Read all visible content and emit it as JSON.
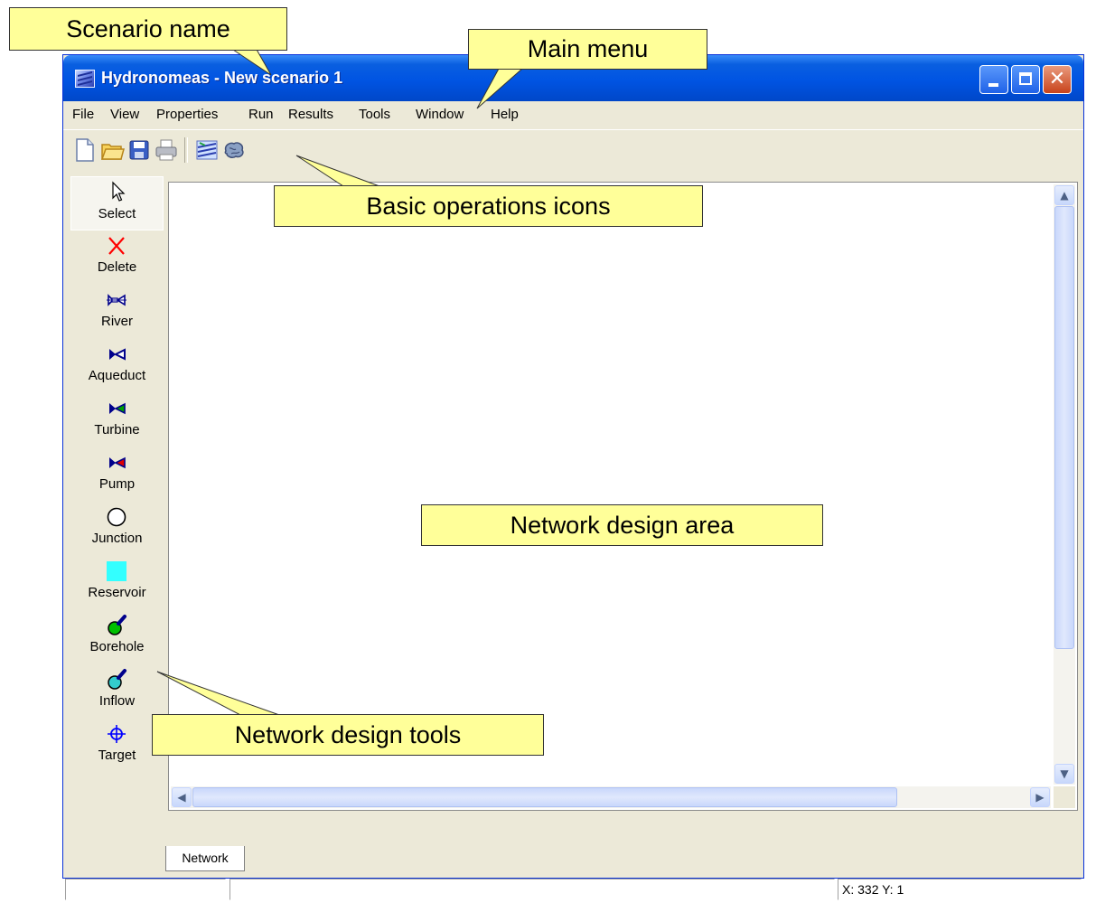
{
  "window": {
    "title": "Hydronomeas - New scenario 1",
    "title_bar_color": "#0054e3",
    "controls": [
      {
        "name": "minimize",
        "glyph": "minimize-icon"
      },
      {
        "name": "maximize",
        "glyph": "maximize-icon"
      },
      {
        "name": "close",
        "glyph": "close-icon",
        "label": "✕"
      }
    ]
  },
  "menu": {
    "items": [
      "File",
      "View",
      "Properties",
      "Run",
      "Results",
      "Tools",
      "Window",
      "Help"
    ]
  },
  "toolbar": {
    "icons": [
      "new-file-icon",
      "open-folder-icon",
      "save-disk-icon",
      "print-icon",
      "run-network-icon",
      "results-brain-icon"
    ]
  },
  "palette": {
    "items": [
      {
        "label": "Select",
        "icon": "cursor-arrow-icon"
      },
      {
        "label": "Delete",
        "icon": "delete-x-icon",
        "color": "#ff0000"
      },
      {
        "label": "River",
        "icon": "river-icon"
      },
      {
        "label": "Aqueduct",
        "icon": "aqueduct-icon"
      },
      {
        "label": "Turbine",
        "icon": "turbine-icon",
        "color": "#00a000"
      },
      {
        "label": "Pump",
        "icon": "pump-icon",
        "color": "#e00000"
      },
      {
        "label": "Junction",
        "icon": "junction-circle-icon"
      },
      {
        "label": "Reservoir",
        "icon": "reservoir-square-icon",
        "color": "#33ffff"
      },
      {
        "label": "Borehole",
        "icon": "borehole-icon",
        "color": "#00c000"
      },
      {
        "label": "Inflow",
        "icon": "inflow-icon",
        "color": "#33cccc"
      },
      {
        "label": "Target",
        "icon": "target-crosshair-icon",
        "color": "#0000ff"
      }
    ],
    "selected": "Select"
  },
  "tabs": [
    {
      "label": "Network"
    }
  ],
  "status": {
    "panel1": "",
    "panel2": "",
    "coords": "X: 332 Y: 1"
  },
  "annotations": {
    "scenario_name": "Scenario name",
    "main_menu": "Main menu",
    "basic_operations": "Basic operations icons",
    "network_design_area": "Network design area",
    "network_design_tools": "Network design tools",
    "callout_color": "#ffff99"
  }
}
